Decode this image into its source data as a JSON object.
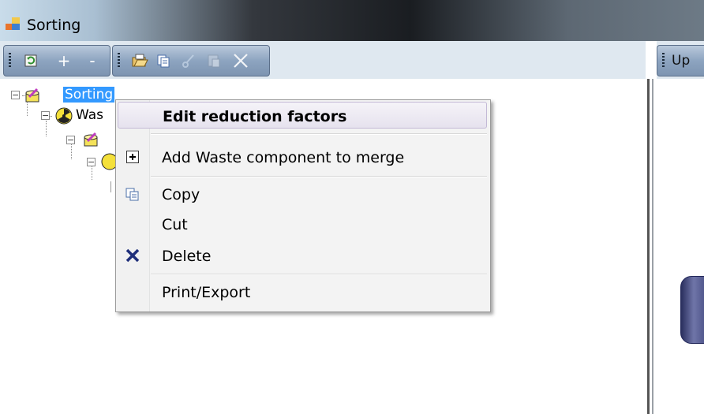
{
  "window": {
    "title": "Sorting",
    "app_icon": "window-app-icon"
  },
  "toolbar1": {
    "buttons": [
      "grip",
      "refresh-icon",
      "+",
      "-"
    ]
  },
  "toolbar2": {
    "buttons": [
      "grip",
      "open-folder-icon",
      "copy-icon",
      "cut-icon",
      "paste-icon",
      "delete-icon"
    ]
  },
  "tree": {
    "root": {
      "label": "Sorting",
      "icon": "sorting-icon",
      "selected": true
    },
    "child": {
      "label": "Was",
      "icon": "radiation-icon"
    }
  },
  "right_panel": {
    "toolbar_label": "Up"
  },
  "context_menu": {
    "items": [
      {
        "label": "Edit reduction factors",
        "icon": "",
        "bold": true
      },
      {
        "label": "Add Waste component to merge",
        "icon": "add-icon"
      },
      {
        "label": "Copy",
        "icon": "copy-icon"
      },
      {
        "label": "Cut",
        "icon": ""
      },
      {
        "label": "Delete",
        "icon": "delete-x-icon"
      },
      {
        "label": "Print/Export",
        "icon": ""
      }
    ]
  },
  "colors": {
    "selection": "#3399ff",
    "toolbar": "#8da4c0",
    "menu_bg": "#f3f3f3"
  }
}
